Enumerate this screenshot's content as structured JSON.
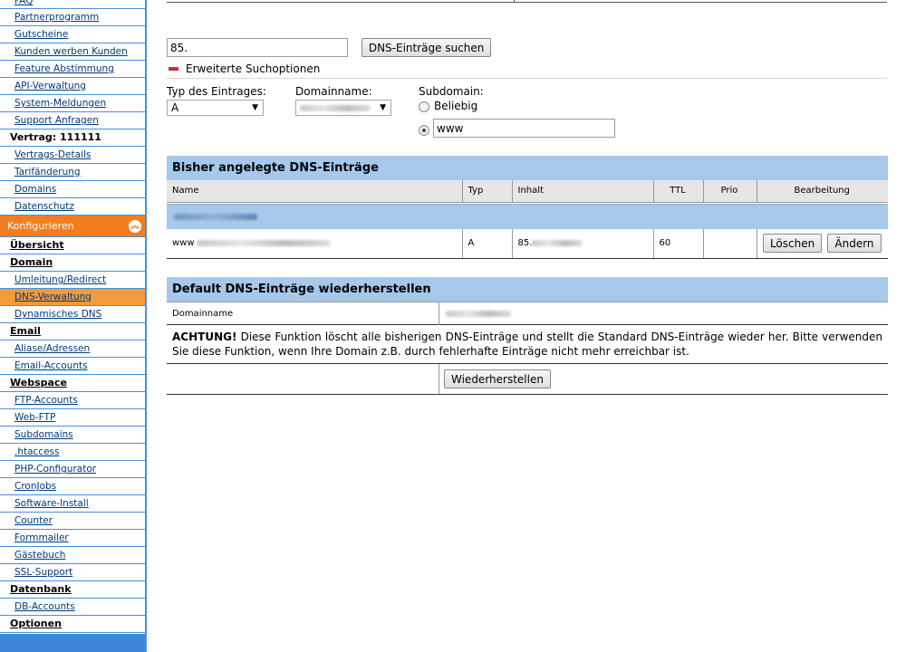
{
  "sidebar": {
    "items_top": [
      {
        "label": "FAQ",
        "type": "link"
      },
      {
        "label": "Partnerprogramm",
        "type": "link"
      },
      {
        "label": "Gutscheine",
        "type": "link"
      },
      {
        "label": "Kunden werben Kunden",
        "type": "link"
      },
      {
        "label": "Feature Abstimmung",
        "type": "link"
      },
      {
        "label": "API-Verwaltung",
        "type": "link"
      },
      {
        "label": "System-Meldungen",
        "type": "link"
      },
      {
        "label": "Support Anfragen",
        "type": "link"
      },
      {
        "label": "Vertrag: 111111",
        "type": "static"
      },
      {
        "label": "Vertrags-Details",
        "type": "link"
      },
      {
        "label": "Tarifänderung",
        "type": "link"
      },
      {
        "label": "Domains",
        "type": "link"
      },
      {
        "label": "Datenschutz",
        "type": "link"
      }
    ],
    "section_label": "Konfigurieren",
    "section_icon": "chevron-up-icon",
    "items_config": [
      {
        "label": "Übersicht",
        "type": "heading"
      },
      {
        "label": "Domain",
        "type": "heading"
      },
      {
        "label": "Umleitung/Redirect",
        "type": "link"
      },
      {
        "label": "DNS-Verwaltung",
        "type": "link",
        "active": true
      },
      {
        "label": "Dynamisches DNS",
        "type": "link"
      },
      {
        "label": "Email",
        "type": "heading"
      },
      {
        "label": "Aliase/Adressen",
        "type": "link"
      },
      {
        "label": "Email-Accounts",
        "type": "link"
      },
      {
        "label": "Webspace",
        "type": "heading"
      },
      {
        "label": "FTP-Accounts",
        "type": "link"
      },
      {
        "label": "Web-FTP",
        "type": "link"
      },
      {
        "label": "Subdomains",
        "type": "link"
      },
      {
        "label": ".htaccess",
        "type": "link"
      },
      {
        "label": "PHP-Configurator",
        "type": "link"
      },
      {
        "label": "CronJobs",
        "type": "link"
      },
      {
        "label": "Software-Install",
        "type": "link"
      },
      {
        "label": "Counter",
        "type": "link"
      },
      {
        "label": "Formmailer",
        "type": "link"
      },
      {
        "label": "Gästebuch",
        "type": "link"
      },
      {
        "label": "SSL-Support",
        "type": "link"
      },
      {
        "label": "Datenbank",
        "type": "heading"
      },
      {
        "label": "DB-Accounts",
        "type": "link"
      },
      {
        "label": "Optionen",
        "type": "heading"
      }
    ]
  },
  "search": {
    "value": "85.",
    "button_label": "DNS-Einträge suchen",
    "advanced_label": "Erweiterte Suchoptionen"
  },
  "filters": {
    "type_label": "Typ des Eintrages:",
    "type_value": "A",
    "domain_label": "Domainname:",
    "subdomain_label": "Subdomain:",
    "subdomain_any_label": "Beliebig",
    "subdomain_value": "www"
  },
  "dns_table": {
    "title": "Bisher angelegte DNS-Einträge",
    "columns": [
      "Name",
      "Typ",
      "Inhalt",
      "TTL",
      "Prio",
      "Bearbeitung"
    ],
    "rows": [
      {
        "name": "www",
        "typ": "A",
        "inhalt": "85.",
        "ttl": "60",
        "prio": ""
      }
    ],
    "delete_label": "Löschen",
    "edit_label": "Ändern"
  },
  "restore": {
    "title": "Default DNS-Einträge wiederherstellen",
    "domain_label": "Domainname",
    "warning_bold": "ACHTUNG!",
    "warning_text": " Diese Funktion löscht alle bisherigen DNS-Einträge und stellt die Standard DNS-Einträge wieder her. Bitte verwenden Sie diese Funktion, wenn Ihre Domain z.B. durch fehlerhafte Einträge nicht mehr erreichbar ist.",
    "button_label": "Wiederherstellen"
  },
  "colors": {
    "accent_orange": "#f47d20",
    "active_item": "#f39a3a",
    "header_blue": "#a6c8ea",
    "border_blue": "#4a90d9"
  }
}
